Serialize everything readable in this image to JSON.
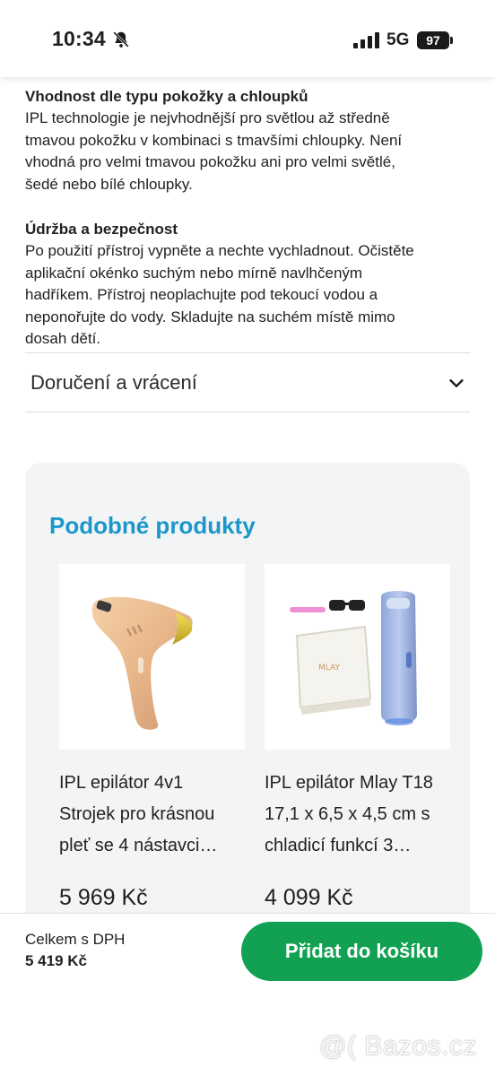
{
  "status_bar": {
    "time": "10:34",
    "network": "5G",
    "battery": "97",
    "icons": [
      "bell-muted-icon",
      "signal-icon",
      "battery-icon"
    ]
  },
  "description": {
    "section1_heading": "Vhodnost dle typu pokožky a chloupků",
    "section1_lines": [
      "IPL technologie je nejvhodnější pro světlou až středně",
      "tmavou pokožku v kombinaci s tmavšími chloupky. Není",
      "vhodná pro velmi tmavou pokožku ani pro velmi světlé,",
      "šedé nebo bílé chloupky."
    ],
    "section2_heading": "Údržba a bezpečnost",
    "section2_lines": [
      "Po použití přístroj vypněte a nechte vychladnout. Očistěte",
      "aplikační okénko suchým nebo mírně navlhčeným",
      "hadříkem. Přístroj neoplachujte pod tekoucí vodou a",
      "neponořujte do vody. Skladujte na suchém místě mimo",
      "dosah dětí."
    ]
  },
  "accordion": {
    "label": "Doručení a vrácení",
    "icon": "chevron-down-icon"
  },
  "similar_products": {
    "title": "Podobné produkty",
    "items": [
      {
        "title_lines": [
          "IPL epilátor 4v1",
          "Strojek pro krásnou",
          "pleť se 4 nástavci…"
        ],
        "price": "5 969 Kč"
      },
      {
        "title_lines": [
          "IPL epilátor Mlay T18",
          "17,1 x 6,5 x 4,5 cm s",
          "chladicí funkcí 3…"
        ],
        "price": "4 099 Kč",
        "box_label": "MLAY"
      }
    ]
  },
  "bottom_bar": {
    "total_label": "Celkem s DPH",
    "total_value": "5 419 Kč",
    "add_to_cart": "Přidat do košíku"
  },
  "watermark": "@( Bazos.cz",
  "colors": {
    "accent_blue": "#1b97c9",
    "button_green": "#12a152"
  }
}
